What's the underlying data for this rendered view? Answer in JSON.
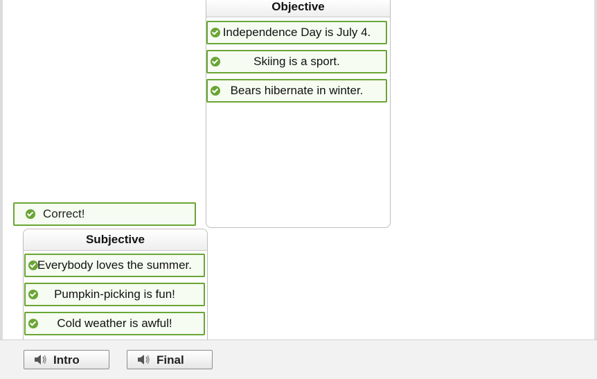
{
  "objective": {
    "title": "Objective",
    "items": [
      "Independence Day is July 4.",
      "Skiing is a sport.",
      "Bears hibernate in winter."
    ]
  },
  "feedback": {
    "text": "Correct!"
  },
  "subjective": {
    "title": "Subjective",
    "items": [
      "Everybody loves the summer.",
      "Pumpkin-picking is fun!",
      "Cold weather is awful!"
    ]
  },
  "footer": {
    "intro_label": "Intro",
    "final_label": "Final",
    "icon": "speaker-icon"
  },
  "colors": {
    "accent": "#6aa535",
    "card_bg": "#f6fcf1"
  }
}
